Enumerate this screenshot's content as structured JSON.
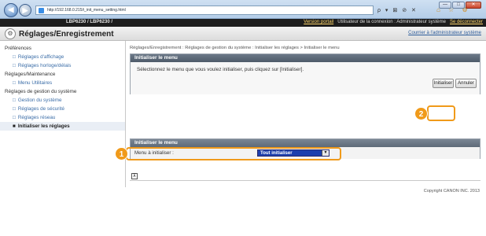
{
  "browser": {
    "address_url": "http://192.168.0.215/i_init_menu_setting.html",
    "address_tools": "ρ ▾ ⊠ ⊘ ✕",
    "window_controls": [
      "—",
      "□",
      "✕"
    ],
    "toolbar_icons": "⌂ ☆ ⚙"
  },
  "header": {
    "model": "LBP6230 / LBP6230 /",
    "link_portal": "Version portail",
    "login_text": "Utilisateur de la connexion : Administrateur système",
    "link_logout": "Se déconnecter"
  },
  "titlebar": {
    "title": "Réglages/Enregistrement",
    "admin_link": "Courrier à l'administrateur système"
  },
  "sidebar": {
    "groups": [
      {
        "label": "Préférences",
        "items": [
          "Réglages d'affichage",
          "Réglages horloge/délais"
        ]
      },
      {
        "label": "Réglages/Maintenance",
        "items": [
          "Menu Utilitaires"
        ]
      },
      {
        "label": "Réglages de gestion du système",
        "items": [
          "Gestion du système",
          "Réglages de sécurité",
          "Réglages réseau",
          "Initialiser les réglages"
        ]
      }
    ]
  },
  "main": {
    "breadcrumb": "Réglages/Enregistrement : Réglages de gestion du système : Initialiser les réglages > Initialiser le menu",
    "panel_title": "Initialiser le menu",
    "instruction": "Sélectionnez le menu que vous voulez initialiser, puis cliquez sur [Initialiser].",
    "init_button": "Initialiser",
    "cancel_button": "Annuler",
    "section_title": "Initialiser le menu",
    "field_label": "Menu à initialiser :",
    "field_value": "Tout initialiser",
    "copyright": "Copyright CANON INC. 2013"
  },
  "callouts": {
    "one": "1",
    "two": "2"
  },
  "colors": {
    "callout": "#f09a1a",
    "select_bg": "#1c3fae",
    "header_band": "#1d1d1d"
  }
}
